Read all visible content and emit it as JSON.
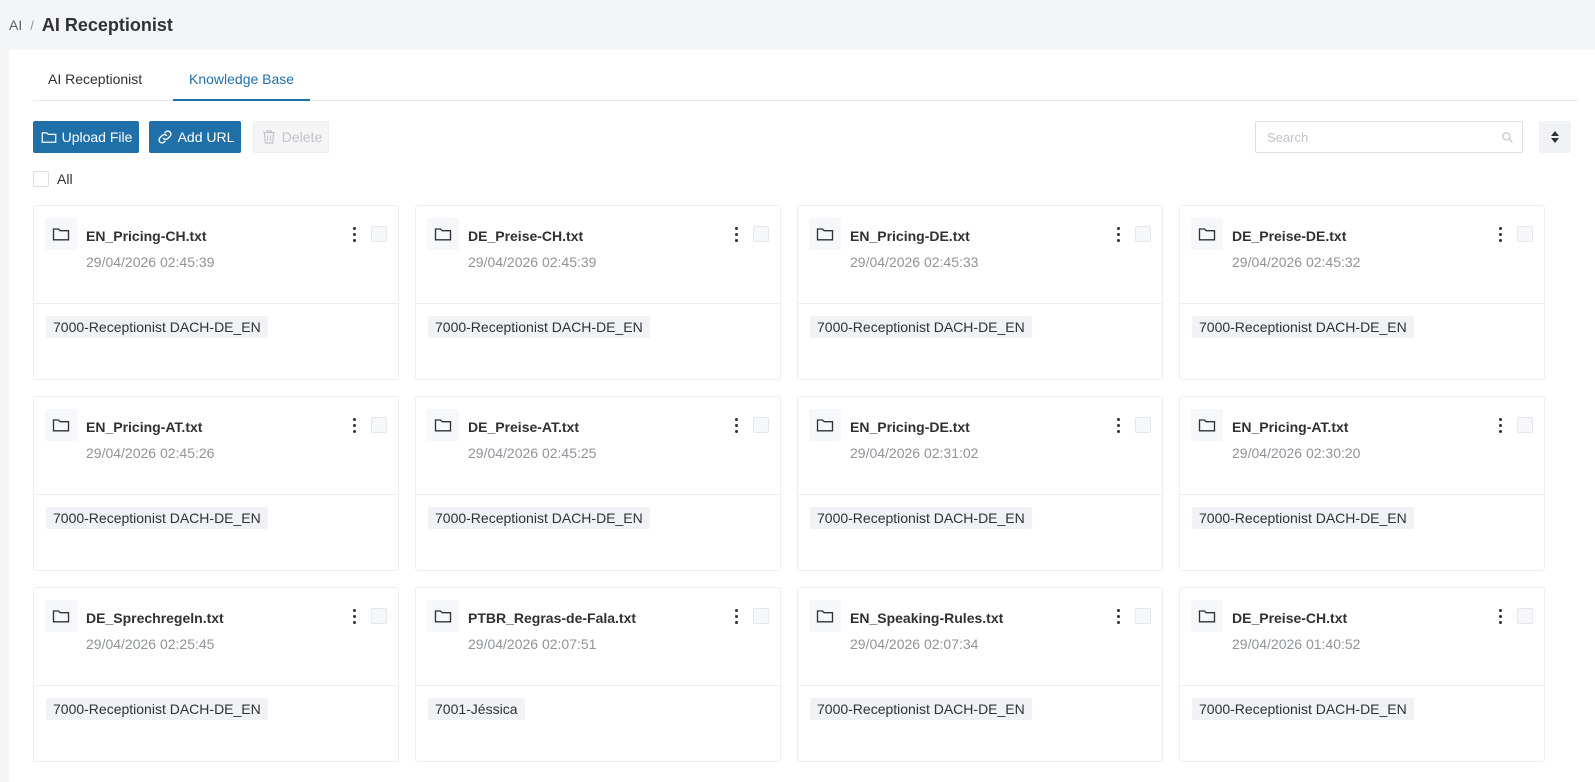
{
  "breadcrumb": {
    "root": "AI",
    "separator": "/",
    "current": "AI Receptionist"
  },
  "tabs": [
    {
      "label": "AI Receptionist",
      "active": false
    },
    {
      "label": "Knowledge Base",
      "active": true
    }
  ],
  "toolbar": {
    "upload_label": "Upload File",
    "add_url_label": "Add URL",
    "delete_label": "Delete",
    "search_placeholder": "Search"
  },
  "select_all_label": "All",
  "colors": {
    "primary": "#1f6fa8",
    "muted": "#909399",
    "tag_bg": "#f0f2f5"
  },
  "files": [
    {
      "name": "EN_Pricing-CH.txt",
      "date": "29/04/2026 02:45:39",
      "tag": "7000-Receptionist DACH-DE_EN"
    },
    {
      "name": "DE_Preise-CH.txt",
      "date": "29/04/2026 02:45:39",
      "tag": "7000-Receptionist DACH-DE_EN"
    },
    {
      "name": "EN_Pricing-DE.txt",
      "date": "29/04/2026 02:45:33",
      "tag": "7000-Receptionist DACH-DE_EN"
    },
    {
      "name": "DE_Preise-DE.txt",
      "date": "29/04/2026 02:45:32",
      "tag": "7000-Receptionist DACH-DE_EN"
    },
    {
      "name": "EN_Pricing-AT.txt",
      "date": "29/04/2026 02:45:26",
      "tag": "7000-Receptionist DACH-DE_EN"
    },
    {
      "name": "DE_Preise-AT.txt",
      "date": "29/04/2026 02:45:25",
      "tag": "7000-Receptionist DACH-DE_EN"
    },
    {
      "name": "EN_Pricing-DE.txt",
      "date": "29/04/2026 02:31:02",
      "tag": "7000-Receptionist DACH-DE_EN"
    },
    {
      "name": "EN_Pricing-AT.txt",
      "date": "29/04/2026 02:30:20",
      "tag": "7000-Receptionist DACH-DE_EN"
    },
    {
      "name": "DE_Sprechregeln.txt",
      "date": "29/04/2026 02:25:45",
      "tag": "7000-Receptionist DACH-DE_EN"
    },
    {
      "name": "PTBR_Regras-de-Fala.txt",
      "date": "29/04/2026 02:07:51",
      "tag": "7001-Jéssica"
    },
    {
      "name": "EN_Speaking-Rules.txt",
      "date": "29/04/2026 02:07:34",
      "tag": "7000-Receptionist DACH-DE_EN"
    },
    {
      "name": "DE_Preise-CH.txt",
      "date": "29/04/2026 01:40:52",
      "tag": "7000-Receptionist DACH-DE_EN"
    }
  ]
}
